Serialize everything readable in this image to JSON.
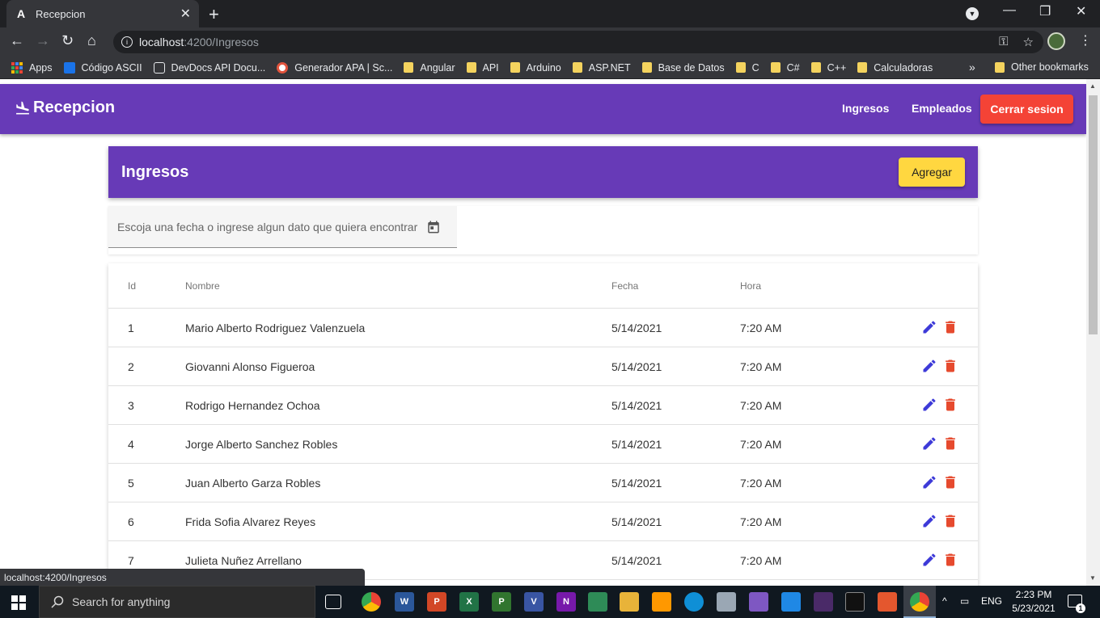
{
  "browser": {
    "tab_title": "Recepcion",
    "tab_favicon_letter": "A",
    "tab_close": "✕",
    "new_tab": "+",
    "url_host": "localhost",
    "url_path": ":4200/Ingresos",
    "status_url": "localhost:4200/Ingresos",
    "bookmarks": [
      {
        "label": "Apps",
        "icon": "apps-grid-icon"
      },
      {
        "label": "Código ASCII",
        "icon": "play-icon"
      },
      {
        "label": "DevDocs API Docu...",
        "icon": "devdocs-icon"
      },
      {
        "label": "Generador APA | Sc...",
        "icon": "apa-icon"
      },
      {
        "label": "Angular",
        "icon": "folder-icon"
      },
      {
        "label": "API",
        "icon": "folder-icon"
      },
      {
        "label": "Arduino",
        "icon": "folder-icon"
      },
      {
        "label": "ASP.NET",
        "icon": "folder-icon"
      },
      {
        "label": "Base de Datos",
        "icon": "folder-icon"
      },
      {
        "label": "C",
        "icon": "folder-icon"
      },
      {
        "label": "C#",
        "icon": "folder-icon"
      },
      {
        "label": "C++",
        "icon": "folder-icon"
      },
      {
        "label": "Calculadoras",
        "icon": "folder-icon"
      }
    ],
    "bookmarks_more": "»",
    "other_bookmarks": "Other bookmarks"
  },
  "app": {
    "brand": "Recepcion",
    "nav": {
      "ingresos": "Ingresos",
      "empleados": "Empleados",
      "logout": "Cerrar sesion"
    },
    "header_title": "Ingresos",
    "add_button": "Agregar",
    "search_placeholder": "Escoja una fecha o ingrese algun dato que quiera encontrar",
    "table": {
      "headers": {
        "id": "Id",
        "nombre": "Nombre",
        "fecha": "Fecha",
        "hora": "Hora"
      },
      "rows": [
        {
          "id": "1",
          "nombre": "Mario Alberto Rodriguez Valenzuela",
          "fecha": "5/14/2021",
          "hora": "7:20 AM"
        },
        {
          "id": "2",
          "nombre": "Giovanni Alonso Figueroa",
          "fecha": "5/14/2021",
          "hora": "7:20 AM"
        },
        {
          "id": "3",
          "nombre": "Rodrigo Hernandez Ochoa",
          "fecha": "5/14/2021",
          "hora": "7:20 AM"
        },
        {
          "id": "4",
          "nombre": "Jorge Alberto Sanchez Robles",
          "fecha": "5/14/2021",
          "hora": "7:20 AM"
        },
        {
          "id": "5",
          "nombre": "Juan Alberto Garza Robles",
          "fecha": "5/14/2021",
          "hora": "7:20 AM"
        },
        {
          "id": "6",
          "nombre": "Frida Sofia Alvarez Reyes",
          "fecha": "5/14/2021",
          "hora": "7:20 AM"
        },
        {
          "id": "7",
          "nombre": "Julieta Nuñez Arrellano",
          "fecha": "5/14/2021",
          "hora": "7:20 AM"
        }
      ]
    },
    "colors": {
      "primary": "#673ab7",
      "accent": "#ffd740",
      "warn": "#f44336",
      "edit_icon": "#3d3ad8",
      "delete_icon": "#e64a2e"
    }
  },
  "taskbar": {
    "search_placeholder": "Search for anything",
    "language": "ENG",
    "time": "2:23 PM",
    "date": "5/23/2021",
    "notification_count": "1",
    "word_letter": "W",
    "powerpoint_letter": "P",
    "excel_letter": "X",
    "project_letter": "P",
    "visio_letter": "V",
    "onenote_letter": "N"
  }
}
